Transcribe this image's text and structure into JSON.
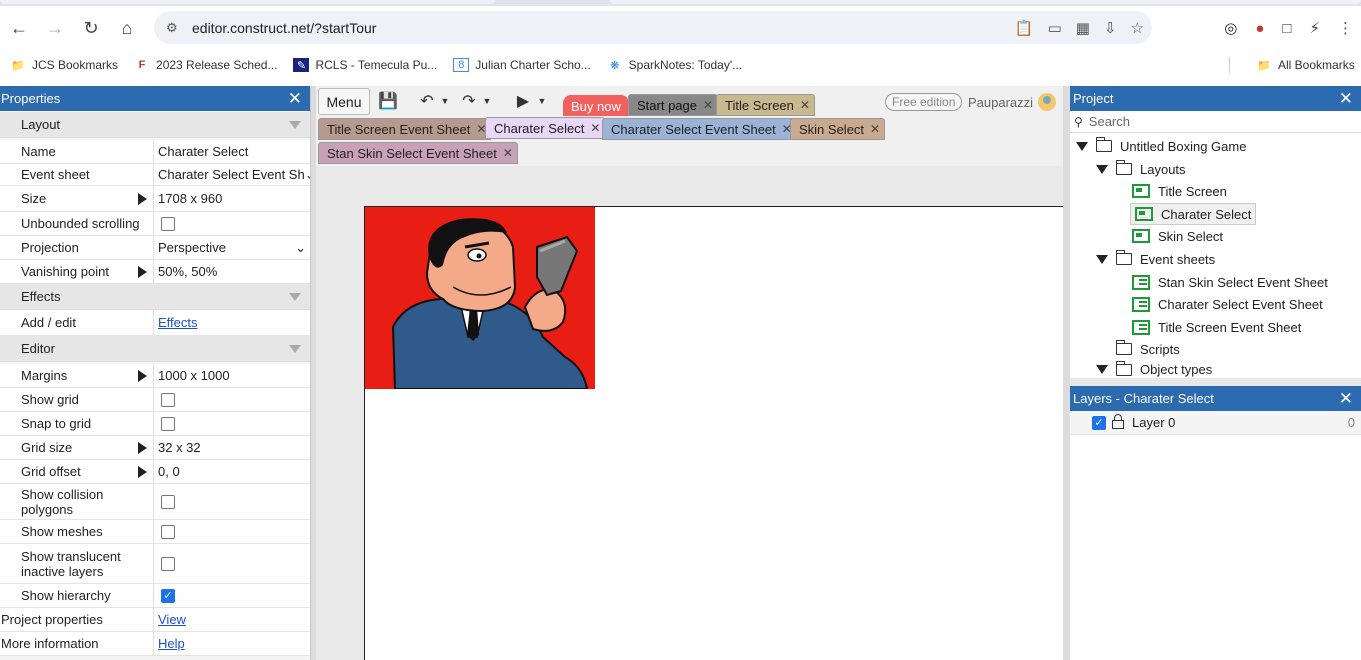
{
  "browser": {
    "url": "editor.construct.net/?startTour",
    "bookmarks": [
      {
        "label": "JCS Bookmarks",
        "icon": "folder-icon"
      },
      {
        "label": "2023 Release Sched...",
        "icon": "red-logo-icon"
      },
      {
        "label": "RCLS - Temecula Pu...",
        "icon": "library-icon"
      },
      {
        "label": "Julian Charter Scho...",
        "icon": "calendar-icon"
      },
      {
        "label": "SparkNotes: Today'...",
        "icon": "asterisk-icon"
      }
    ],
    "all_bookmarks": "All Bookmarks"
  },
  "properties": {
    "title": "Properties",
    "sections": {
      "layout": "Layout",
      "effects": "Effects",
      "editor": "Editor"
    },
    "rows": {
      "name": {
        "label": "Name",
        "value": "Charater Select"
      },
      "event_sheet": {
        "label": "Event sheet",
        "value": "Charater Select Event Sh"
      },
      "size": {
        "label": "Size",
        "value": "1708 x 960"
      },
      "unbounded": {
        "label": "Unbounded scrolling"
      },
      "projection": {
        "label": "Projection",
        "value": "Perspective"
      },
      "vanishing": {
        "label": "Vanishing point",
        "value": "50%, 50%"
      },
      "add_edit": {
        "label": "Add / edit",
        "value": "Effects"
      },
      "margins": {
        "label": "Margins",
        "value": "1000 x 1000"
      },
      "show_grid": {
        "label": "Show grid"
      },
      "snap": {
        "label": "Snap to grid"
      },
      "grid_size": {
        "label": "Grid size",
        "value": "32 x 32"
      },
      "grid_offset": {
        "label": "Grid offset",
        "value": "0, 0"
      },
      "collision": {
        "label": "Show collision polygons"
      },
      "meshes": {
        "label": "Show meshes"
      },
      "translucent": {
        "label": "Show translucent inactive layers"
      },
      "hierarchy": {
        "label": "Show hierarchy",
        "checked": true
      },
      "project_props": {
        "label": "Project properties",
        "value": "View"
      },
      "more_info": {
        "label": "More information",
        "value": "Help"
      }
    }
  },
  "toolbar": {
    "menu": "Menu",
    "buy_now": "Buy now",
    "free_edition": "Free edition",
    "username": "Pauparazzi"
  },
  "tabs": {
    "row1": [
      "Start page",
      "Title Screen"
    ],
    "row2": [
      "Title Screen Event Sheet",
      "Charater Select",
      "Charater Select Event Sheet",
      "Skin Select"
    ],
    "row3": [
      "Stan Skin Select Event Sheet"
    ]
  },
  "project": {
    "title": "Project",
    "search_placeholder": "Search",
    "root": "Untitled Boxing Game",
    "layouts_folder": "Layouts",
    "layouts": [
      "Title Screen",
      "Charater Select",
      "Skin Select"
    ],
    "event_sheets_folder": "Event sheets",
    "event_sheets": [
      "Stan Skin Select Event Sheet",
      "Charater Select Event Sheet",
      "Title Screen Event Sheet"
    ],
    "scripts_folder": "Scripts",
    "object_types_folder": "Object types"
  },
  "layers": {
    "title": "Layers - Charater Select",
    "items": [
      {
        "name": "Layer 0",
        "index": "0"
      }
    ]
  },
  "colors": {
    "panel_header": "#2d6bb0",
    "buy_now": "#f2615e",
    "sprite_bg": "#e81d14",
    "accent_green": "#1f9a3a"
  }
}
